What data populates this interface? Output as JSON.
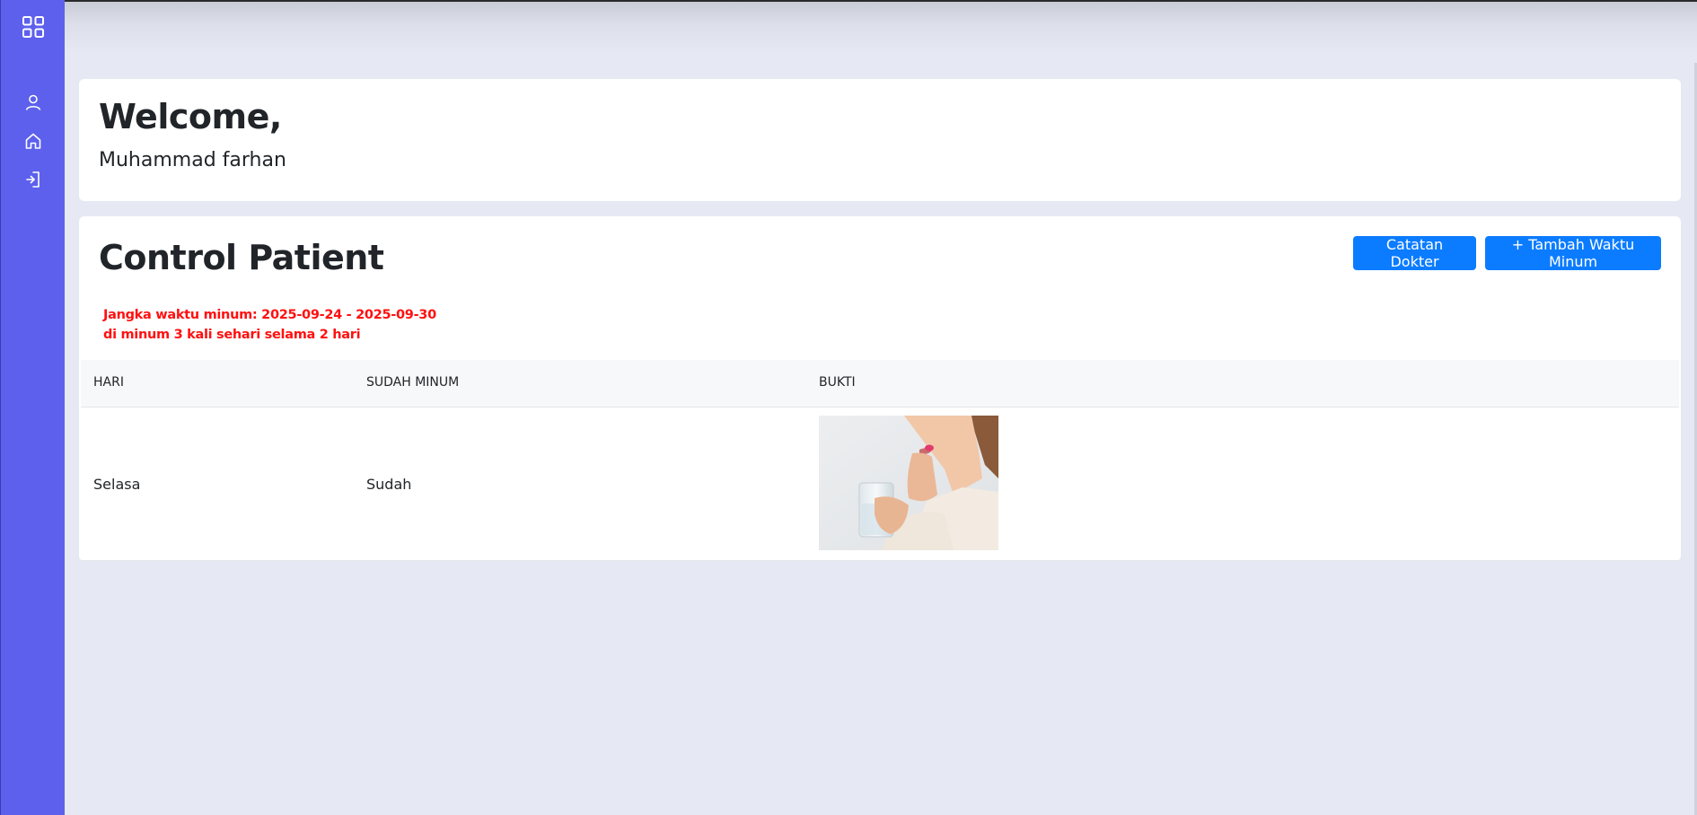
{
  "sidebar": {
    "icons": [
      "grid-icon",
      "user-icon",
      "home-icon",
      "logout-icon"
    ]
  },
  "welcome": {
    "title": "Welcome,",
    "name": "Muhammad farhan"
  },
  "control": {
    "title": "Control Patient",
    "buttons": {
      "doctor_notes": "Catatan Dokter",
      "add_time": "+ Tambah Waktu Minum"
    },
    "notice": {
      "line1": "Jangka waktu minum: 2025-09-24 - 2025-09-30",
      "line2": "di minum 3 kali sehari selama 2 hari"
    },
    "table": {
      "headers": [
        "HARI",
        "SUDAH MINUM",
        "BUKTI"
      ],
      "rows": [
        {
          "day": "Selasa",
          "status": "Sudah",
          "proof_icon": "proof-photo"
        }
      ]
    }
  },
  "colors": {
    "sidebar": "#5d60ec",
    "background": "#e6e9f3",
    "button": "#0b7cff",
    "notice": "#ff1010"
  }
}
